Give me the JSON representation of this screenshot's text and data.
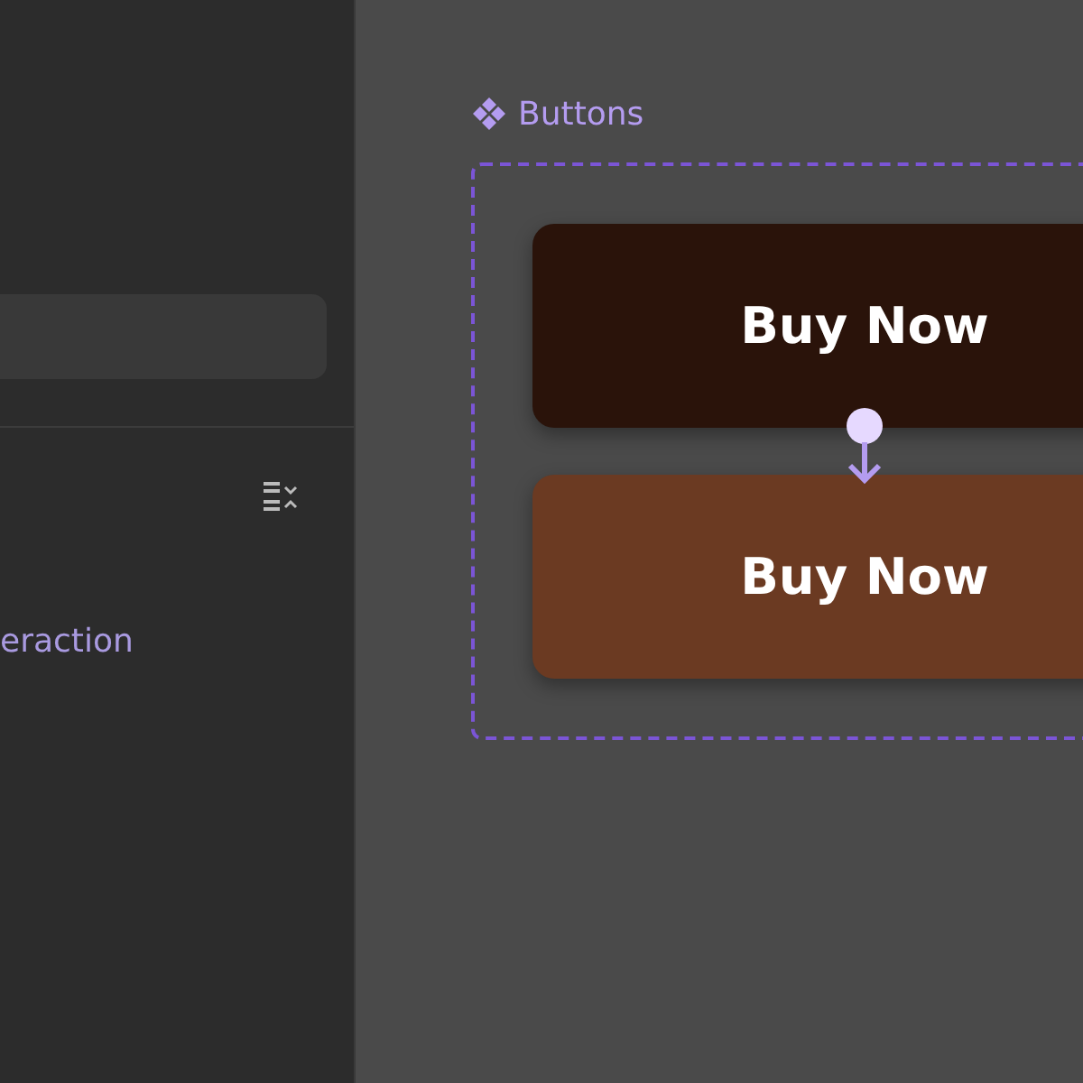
{
  "layers_panel": {
    "interaction_label": "eraction"
  },
  "canvas": {
    "component_set": {
      "title": "Buttons",
      "variants": [
        {
          "label": "Buy Now",
          "color": "#2a130a"
        },
        {
          "label": "Buy Now",
          "color": "#6b3a22"
        }
      ]
    }
  }
}
